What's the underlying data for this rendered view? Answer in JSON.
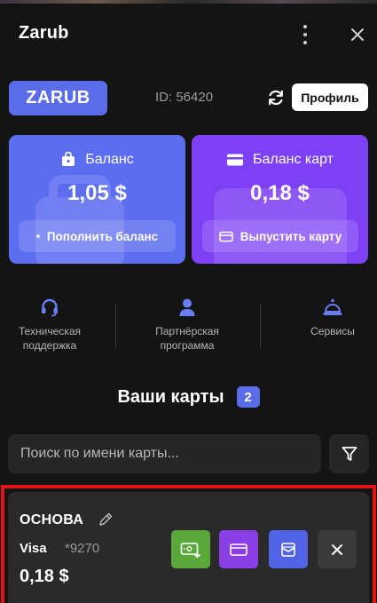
{
  "header": {
    "title": "Zarub"
  },
  "account": {
    "logo": "ZARUB",
    "id_text": "ID: 56420",
    "profile_label": "Профиль"
  },
  "balances": {
    "main": {
      "label": "Баланс",
      "amount": "1,05 $",
      "action": "Пополнить баланс",
      "color": "#5c6df0"
    },
    "cards": {
      "label": "Баланс карт",
      "amount": "0,18 $",
      "action": "Выпустить карту",
      "color": "#7e40f5"
    }
  },
  "links": [
    {
      "line1": "Техническая",
      "line2": "поддержка",
      "icon": "headset-icon"
    },
    {
      "line1": "Партнёрская",
      "line2": "программа",
      "icon": "person-icon"
    },
    {
      "line1": "Сервисы",
      "line2": "",
      "icon": "service-bell-icon"
    }
  ],
  "cards_section": {
    "title": "Ваши карты",
    "count": "2",
    "search_placeholder": "Поиск по имени карты..."
  },
  "cards": [
    {
      "name": "ОСНОВА",
      "type": "Visa",
      "number": "*9270",
      "balance": "0,18 $",
      "actions": [
        {
          "icon": "topup-card-icon",
          "color": "#5aa83a"
        },
        {
          "icon": "card-icon",
          "color": "#8a3fe6"
        },
        {
          "icon": "envelope-icon",
          "color": "#5264e6"
        },
        {
          "icon": "close-icon",
          "color": "#3a3a3a"
        }
      ]
    }
  ],
  "colors": {
    "accent": "#5b6ce8",
    "background": "#141414",
    "highlight": "#e01414"
  }
}
